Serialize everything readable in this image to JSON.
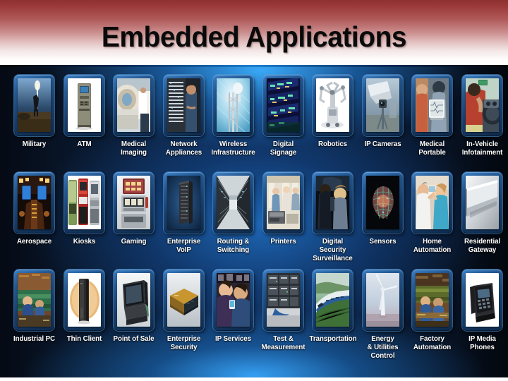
{
  "slide": {
    "title": "Embedded Applications",
    "colors": {
      "header_top": "#8f3030",
      "header_bottom": "#ffffff",
      "body_dark": "#050a14",
      "body_glow": "#3caff f",
      "accent_blue": "#1b7fd0",
      "tile_frame": "#245a96",
      "label_text": "#ffffff",
      "title_text": "#0a0a0a"
    }
  },
  "grid": {
    "columns": 10,
    "rows": 3,
    "tiles": [
      {
        "label": "Military",
        "image": "soldier-antenna-photo"
      },
      {
        "label": "ATM",
        "image": "atm-machine-photo"
      },
      {
        "label": "Medical\nImaging",
        "image": "mri-scanner-photo"
      },
      {
        "label": "Network\nAppliances",
        "image": "network-rack-technician-photo"
      },
      {
        "label": "Wireless\nInfrastructure",
        "image": "cell-tower-photo"
      },
      {
        "label": "Digital\nSignage",
        "image": "digital-signage-boards-photo"
      },
      {
        "label": "Robotics",
        "image": "surgical-robot-photo"
      },
      {
        "label": "IP Cameras",
        "image": "ip-camera-photo"
      },
      {
        "label": "Medical\nPortable",
        "image": "portable-medical-device-photo"
      },
      {
        "label": "In-Vehicle\nInfotainment",
        "image": "car-dashboard-driver-photo"
      },
      {
        "label": "Aerospace",
        "image": "aircraft-cockpit-photo"
      },
      {
        "label": "Kiosks",
        "image": "vending-kiosks-photo"
      },
      {
        "label": "Gaming",
        "image": "slot-machine-photo"
      },
      {
        "label": "Enterprise\nVoIP",
        "image": "server-tower-photo"
      },
      {
        "label": "Routing &\nSwitching",
        "image": "datacenter-aisle-photo"
      },
      {
        "label": "Printers",
        "image": "office-printer-photo"
      },
      {
        "label": "Digital Security\nSurveillance",
        "image": "vehicle-surveillance-photo"
      },
      {
        "label": "Sensors",
        "image": "face-scan-sensor-photo"
      },
      {
        "label": "Home\nAutomation",
        "image": "home-thermostat-couple-photo"
      },
      {
        "label": "Residential\nGateway",
        "image": "residential-gateway-device-photo"
      },
      {
        "label": "Industrial PC",
        "image": "factory-floor-worker-photo"
      },
      {
        "label": "Thin Client",
        "image": "thin-client-device-photo"
      },
      {
        "label": "Point of Sale",
        "image": "pos-terminal-photo"
      },
      {
        "label": "Enterprise\nSecurity",
        "image": "security-appliance-box-photo"
      },
      {
        "label": "IP Services",
        "image": "people-mobile-phones-photo"
      },
      {
        "label": "Test &\nMeasurement",
        "image": "test-instrument-rack-photo"
      },
      {
        "label": "Transportation",
        "image": "high-speed-train-photo"
      },
      {
        "label": "Energy\n& Utilities\nControl",
        "image": "wind-turbine-photo"
      },
      {
        "label": "Factory\nAutomation",
        "image": "assembly-line-photo"
      },
      {
        "label": "IP Media\nPhones",
        "image": "ip-desk-phone-photo"
      }
    ]
  }
}
